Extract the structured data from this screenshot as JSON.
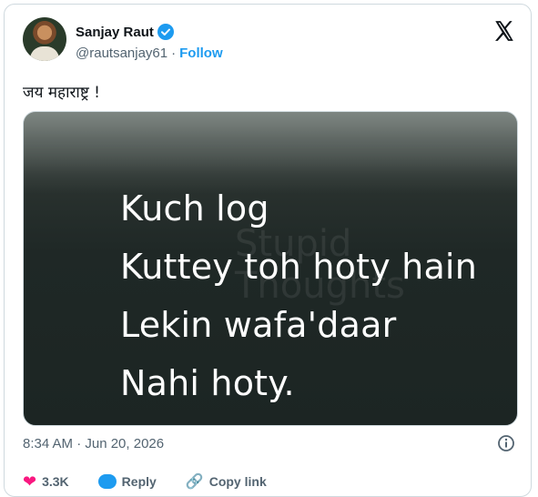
{
  "author": {
    "name": "Sanjay Raut",
    "handle": "@rautsanjay61",
    "separator": "·",
    "follow_label": "Follow"
  },
  "tweet": {
    "text": "जय महाराष्ट्र !",
    "timestamp": "8:34 AM · Jun 20, 2026"
  },
  "media": {
    "watermark": "Stupid Thoughts",
    "lines": [
      "Kuch log",
      "Kuttey toh hoty hain",
      "Lekin wafa'daar",
      "Nahi hoty."
    ]
  },
  "actions": {
    "likes": "3.3K",
    "reply_label": "Reply",
    "copy_label": "Copy link"
  },
  "icons": {
    "platform": "x-logo-icon",
    "verified": "verified-badge-icon",
    "info": "info-icon",
    "like": "heart-icon",
    "reply": "reply-icon",
    "copy": "link-icon"
  },
  "colors": {
    "accent": "#1d9bf0",
    "like": "#f91880",
    "muted": "#536471"
  }
}
